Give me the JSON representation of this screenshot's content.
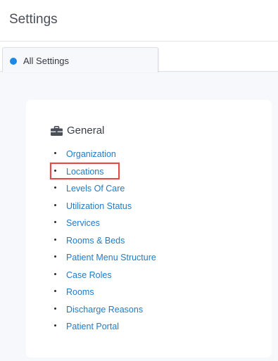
{
  "header": {
    "title": "Settings"
  },
  "tabs": [
    {
      "label": "All Settings",
      "active": true,
      "dot_color": "#1e88e5"
    }
  ],
  "section": {
    "icon": "briefcase-icon",
    "title": "General",
    "links": [
      "Organization",
      "Locations",
      "Levels Of Care",
      "Utilization Status",
      "Services",
      "Rooms & Beds",
      "Patient Menu Structure",
      "Case Roles",
      "Rooms",
      "Discharge Reasons",
      "Patient Portal"
    ]
  },
  "highlight": {
    "target": "Locations",
    "color": "#e24b4b"
  },
  "colors": {
    "link": "#1e7bcc",
    "background": "#f6f8fb",
    "card": "#ffffff"
  }
}
